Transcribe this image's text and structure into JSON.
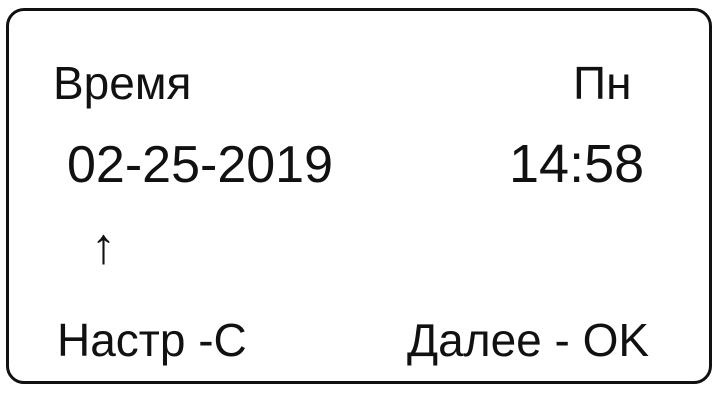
{
  "display": {
    "time_label": "Время",
    "day_of_week": "Пн",
    "date": "02-25-2019",
    "time": "14:58",
    "cursor_arrow": "↑",
    "hint_setup": "Настр -C",
    "hint_next": "Далее - OK"
  },
  "colors": {
    "text": "#111111",
    "background": "#ffffff",
    "border": "#111111"
  },
  "icons": {
    "cursor": "up-arrow-icon"
  }
}
